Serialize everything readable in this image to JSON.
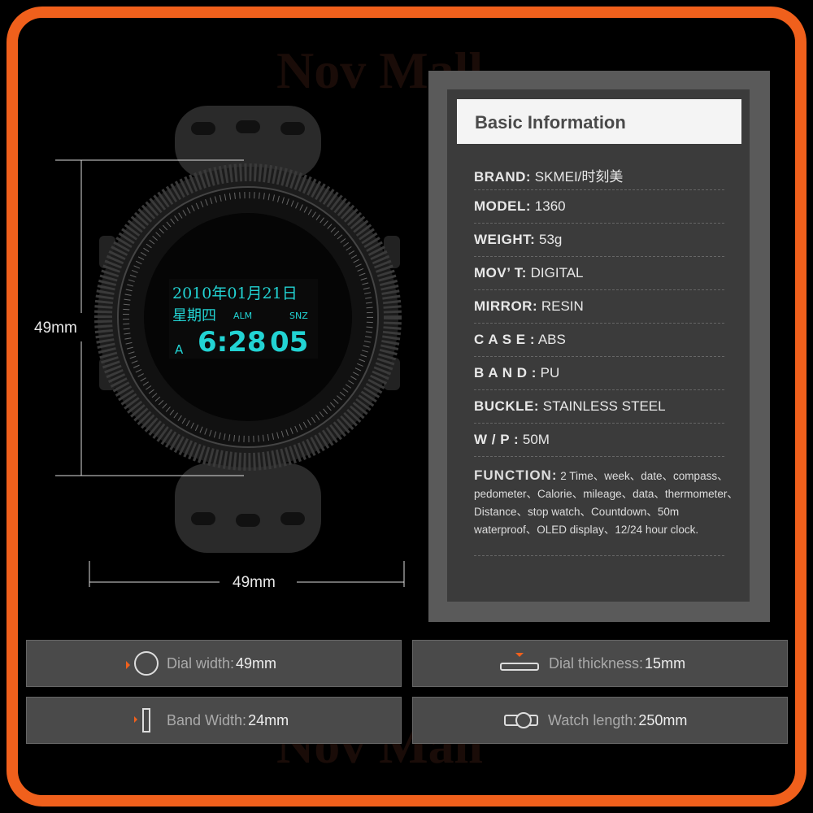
{
  "watermark": "Nov Mall",
  "watch_display": {
    "date": "2010年01月21日",
    "weekday": "星期四",
    "alm": "ALM",
    "snz": "SNZ",
    "am_indicator": "A",
    "time": "6:28",
    "seconds": "05",
    "color": "#22d3d3"
  },
  "dimensions": {
    "height": "49mm",
    "width": "49mm"
  },
  "info": {
    "title": "Basic Information",
    "rows": [
      {
        "label": "BRAND:",
        "value": "SKMEI/时刻美"
      },
      {
        "label": "MODEL:",
        "value": "1360"
      },
      {
        "label": "WEIGHT:",
        "value": "53g"
      },
      {
        "label": "MOV’ T:",
        "value": "DIGITAL"
      },
      {
        "label": "MIRROR:",
        "value": "RESIN"
      },
      {
        "label": "C A S E :",
        "value": "ABS"
      },
      {
        "label": "B A N D :",
        "value": "PU"
      },
      {
        "label": "BUCKLE:",
        "value": "STAINLESS STEEL"
      },
      {
        "label": "W / P :",
        "value": "50M"
      }
    ],
    "function_label": "FUNCTION:",
    "function_text": "2 Time、week、date、compass、pedometer、Calorie、mileage、data、thermometer、Distance、stop watch、Countdown、50m waterproof、OLED display、12/24 hour clock."
  },
  "specs": [
    {
      "icon": "dial-width-icon",
      "label": "Dial width:",
      "value": "49mm"
    },
    {
      "icon": "dial-thickness-icon",
      "label": "Dial thickness:",
      "value": "15mm"
    },
    {
      "icon": "band-width-icon",
      "label": "Band Width:",
      "value": "24mm"
    },
    {
      "icon": "watch-length-icon",
      "label": "Watch length:",
      "value": "250mm"
    }
  ],
  "accent": "#f0601c"
}
